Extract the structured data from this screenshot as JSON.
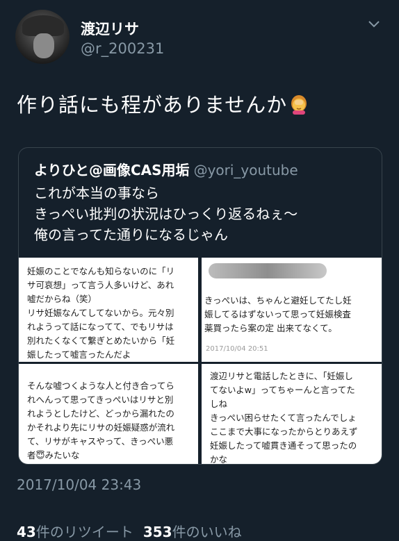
{
  "user": {
    "display_name": "渡辺リサ",
    "handle": "@r_200231"
  },
  "tweet": {
    "text": "作り話にも程がありませんか",
    "emoji": "face-palm-emoji"
  },
  "quote": {
    "name": "よりひと@画像CAS用垢",
    "handle": "@yori_youtube",
    "lines": [
      "これが本当の事なら",
      "きっぺい批判の状況はひっくり返るねぇ〜",
      "俺の言ってた通りになるじゃん"
    ],
    "images": [
      {
        "text": "妊娠のことでなんも知らないのに「リ\nサ可哀想」って言う人多いけど、あれ\n嘘だからね（笑）\nリサ妊娠なんてしてないから。元々別\nれようって話になってて、でもリサは\n別れたくなくて繋ぎとめたいから「妊\n娠したって嘘言ったんだよ"
      },
      {
        "text": "きっぺいは、ちゃんと避妊してたし妊\n娠してるはずないって思って妊娠検査\n薬買ったら案の定 出来てなくて。",
        "timestamp": "2017/10/04 20:51"
      },
      {
        "text": "そんな嘘つくような人と付き合ってら\nれへんって思ってきっぺいはリサと別\nれようとしたけど、どっから漏れたの\nかそれより先にリサの妊娠疑惑が流れ\nて、リサがキャスやって、きっぺい悪\n者😇みたいな"
      },
      {
        "text": "渡辺リサと電話したときに、「妊娠し\nてないよw」ってちゃーんと言ってた\nしね\nきっぺい困らせたくて言ったんでしょ\nここまで大事になったからとりあえず\n妊娠したって嘘貫き通そって思ったの\nかな"
      }
    ]
  },
  "timestamp": "2017/10/04 23:43",
  "stats": {
    "retweets_count": "43",
    "retweets_label": "件のリツイート",
    "likes_count": "353",
    "likes_label": "件のいいね"
  },
  "colors": {
    "background": "#15202b",
    "secondary_text": "#8899a6",
    "border": "#38444d"
  }
}
